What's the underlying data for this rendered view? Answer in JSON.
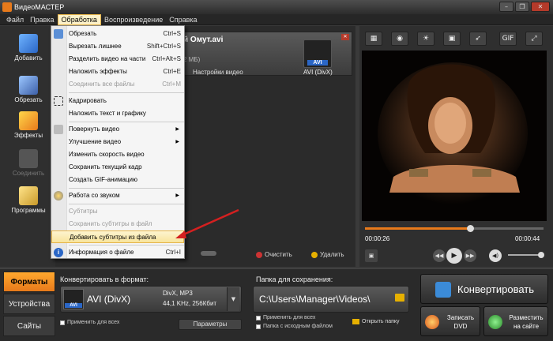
{
  "window": {
    "title": "ВидеоМАСТЕР",
    "controls": [
      "–",
      "❐",
      "✕"
    ]
  },
  "menubar": {
    "items": [
      "Файл",
      "Правка",
      "Обработка",
      "Воспроизведение",
      "Справка"
    ],
    "active": "Обработка"
  },
  "left_panel": {
    "tools": [
      {
        "label": "Добавить",
        "icon": "add-file-icon"
      },
      {
        "label": "Обрезать",
        "icon": "cut-icon"
      },
      {
        "label": "Эффекты",
        "icon": "effects-icon"
      },
      {
        "label": "Соединить",
        "icon": "join-icon",
        "disabled": true
      },
      {
        "label": "Программы",
        "icon": "programs-icon"
      }
    ]
  },
  "file": {
    "name": "й Омут.avi",
    "size": "2 МБ)",
    "settings_label": "Настройки видео",
    "badge": "AVI",
    "codec": "AVI (DivX)"
  },
  "list_actions": {
    "clear": "Очистить",
    "delete": "Удалить"
  },
  "dropdown": {
    "items": [
      {
        "label": "Обрезать",
        "shortcut": "Ctrl+S"
      },
      {
        "label": "Вырезать лишнее",
        "shortcut": "Shift+Ctrl+S"
      },
      {
        "label": "Разделить видео на части",
        "shortcut": "Ctrl+Alt+S"
      },
      {
        "label": "Наложить эффекты",
        "shortcut": "Ctrl+E"
      },
      {
        "label": "Соединить все файлы",
        "shortcut": "Ctrl+M",
        "disabled": true
      },
      {
        "label": "Кадрировать"
      },
      {
        "label": "Наложить текст и графику"
      },
      {
        "label": "Повернуть видео",
        "submenu": true
      },
      {
        "label": "Улучшение видео",
        "submenu": true
      },
      {
        "label": "Изменить скорость видео"
      },
      {
        "label": "Сохранить текущий кадр"
      },
      {
        "label": "Создать GIF-анимацию"
      },
      {
        "label": "Работа со звуком",
        "submenu": true
      },
      {
        "label": "Субтитры",
        "disabled": true
      },
      {
        "label": "Сохранить субтитры в файл",
        "disabled": true
      },
      {
        "label": "Добавить субтитры из файла",
        "highlighted": true
      },
      {
        "label": "Информация о файле",
        "shortcut": "Ctrl+I"
      }
    ]
  },
  "player": {
    "tools": [
      "crop-icon",
      "snapshot-icon",
      "brightness-icon",
      "video-icon",
      "speed-icon",
      "gif-icon",
      "fullscreen-icon"
    ],
    "gif_label": "GIF",
    "time_current": "00:00:26",
    "time_total": "00:00:44",
    "progress": 0.59,
    "volume": 0.95
  },
  "bottom": {
    "tabs": [
      "Форматы",
      "Устройства",
      "Сайты"
    ],
    "active_tab": "Форматы",
    "convert_label": "Конвертировать в формат:",
    "format_badge": "AVI",
    "format_name": "AVI (DivX)",
    "format_details_1": "DivX, MP3",
    "format_details_2": "44,1 KHz, 256Кбит",
    "apply_all": "Применить для всех",
    "params": "Параметры",
    "save_label": "Папка для сохранения:",
    "save_path": "C:\\Users\\Manager\\Videos\\",
    "apply_all_save": "Применить для всех",
    "source_folder": "Папка с исходным файлом",
    "open_folder": "Открыть папку",
    "convert_button": "Конвертировать",
    "dvd_button": "Записать DVD",
    "site_button": "Разместить на сайте"
  },
  "colors": {
    "accent": "#e87a1b",
    "highlight": "#f8e49c",
    "arrow": "#d42020"
  }
}
